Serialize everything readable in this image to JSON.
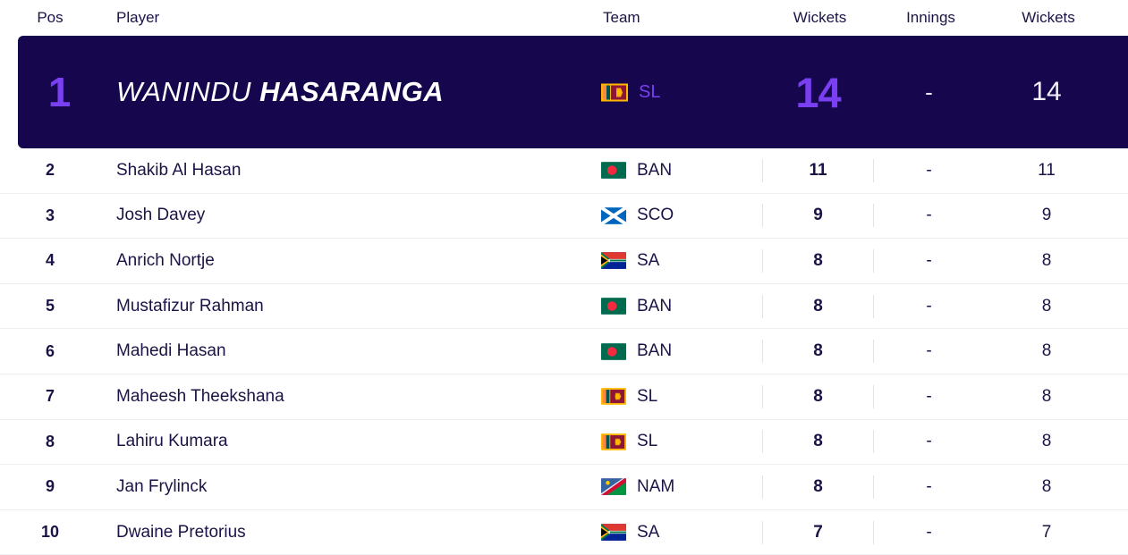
{
  "table": {
    "columns": [
      {
        "key": "pos",
        "label": "Pos"
      },
      {
        "key": "player",
        "label": "Player"
      },
      {
        "key": "team",
        "label": "Team"
      },
      {
        "key": "wickets",
        "label": "Wickets"
      },
      {
        "key": "innings",
        "label": "Innings"
      },
      {
        "key": "wickets2",
        "label": "Wickets"
      }
    ]
  },
  "colors": {
    "highlight_background": "#15064d",
    "accent_purple": "#7b3ff2",
    "text_dark": "#1a1446",
    "row_divider": "#f0f0f4",
    "separator": "#e3e3ea",
    "page_background": "#ffffff"
  },
  "highlight_row": {
    "pos": "1",
    "player_first": "WANINDU",
    "player_last": "HASARANGA",
    "team_code": "SL",
    "team_flag": "flag-sri-lanka-icon",
    "wickets": "14",
    "innings": "-",
    "wickets2": "14"
  },
  "rows": [
    {
      "pos": "2",
      "player": "Shakib Al Hasan",
      "team_code": "BAN",
      "team_flag": "flag-bangladesh-icon",
      "wickets": "11",
      "innings": "-",
      "wickets2": "11"
    },
    {
      "pos": "3",
      "player": "Josh Davey",
      "team_code": "SCO",
      "team_flag": "flag-scotland-icon",
      "wickets": "9",
      "innings": "-",
      "wickets2": "9"
    },
    {
      "pos": "4",
      "player": "Anrich Nortje",
      "team_code": "SA",
      "team_flag": "flag-south-africa-icon",
      "wickets": "8",
      "innings": "-",
      "wickets2": "8"
    },
    {
      "pos": "5",
      "player": "Mustafizur Rahman",
      "team_code": "BAN",
      "team_flag": "flag-bangladesh-icon",
      "wickets": "8",
      "innings": "-",
      "wickets2": "8"
    },
    {
      "pos": "6",
      "player": "Mahedi Hasan",
      "team_code": "BAN",
      "team_flag": "flag-bangladesh-icon",
      "wickets": "8",
      "innings": "-",
      "wickets2": "8"
    },
    {
      "pos": "7",
      "player": "Maheesh Theekshana",
      "team_code": "SL",
      "team_flag": "flag-sri-lanka-icon",
      "wickets": "8",
      "innings": "-",
      "wickets2": "8"
    },
    {
      "pos": "8",
      "player": "Lahiru Kumara",
      "team_code": "SL",
      "team_flag": "flag-sri-lanka-icon",
      "wickets": "8",
      "innings": "-",
      "wickets2": "8"
    },
    {
      "pos": "9",
      "player": "Jan Frylinck",
      "team_code": "NAM",
      "team_flag": "flag-namibia-icon",
      "wickets": "8",
      "innings": "-",
      "wickets2": "8"
    },
    {
      "pos": "10",
      "player": "Dwaine Pretorius",
      "team_code": "SA",
      "team_flag": "flag-south-africa-icon",
      "wickets": "7",
      "innings": "-",
      "wickets2": "7"
    }
  ]
}
